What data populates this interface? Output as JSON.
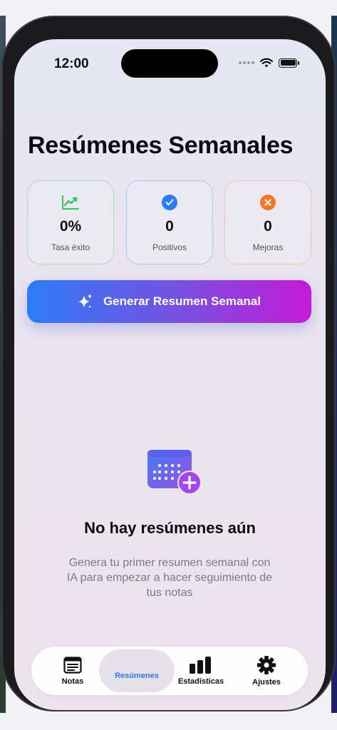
{
  "status_bar": {
    "time": "12:00"
  },
  "header": {
    "title": "Resúmenes Semanales"
  },
  "stats": [
    {
      "icon": "trend-chart-icon",
      "value": "0%",
      "label": "Tasa éxito",
      "color": "#34c759"
    },
    {
      "icon": "checkmark-circle-icon",
      "value": "0",
      "label": "Positivos",
      "color": "#2b7cf4"
    },
    {
      "icon": "x-circle-icon",
      "value": "0",
      "label": "Mejoras",
      "color": "#f5752a"
    }
  ],
  "generate_button": {
    "icon": "sparkles-icon",
    "label": "Generar Resumen Semanal"
  },
  "empty_state": {
    "icon": "calendar-add-icon",
    "title": "No hay resúmenes aún",
    "description": "Genera tu primer resumen semanal con IA para empezar a hacer seguimiento de tus notas"
  },
  "tab_bar": {
    "tabs": [
      {
        "icon": "notes-icon",
        "label": "Notas",
        "active": false
      },
      {
        "icon": "summaries-icon",
        "label": "Resúmenes",
        "active": true
      },
      {
        "icon": "bar-chart-icon",
        "label": "Estadísticas",
        "active": false
      },
      {
        "icon": "gear-icon",
        "label": "Ajustes",
        "active": false
      }
    ]
  },
  "colors": {
    "accent": "#2b7cf4",
    "gradient_start": "#2d7cf6",
    "gradient_end": "#c41ad8"
  }
}
